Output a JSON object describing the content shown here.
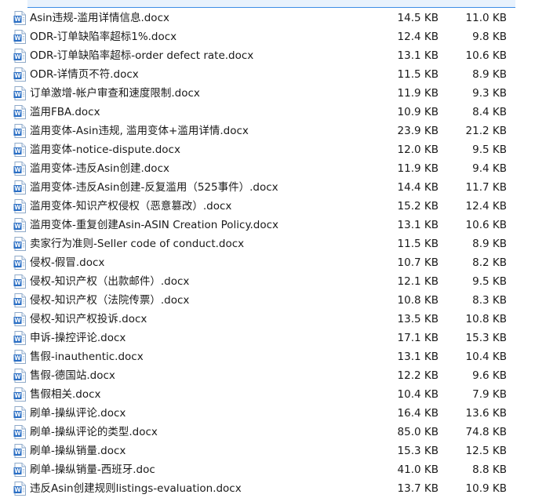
{
  "file_icon": "word-document-icon",
  "colors": {
    "icon_blue": "#2b6fc4",
    "selection": "#3d8ee6",
    "text": "#1a1a1a"
  },
  "files": [
    {
      "name": "Asin违规-滥用详情信息.docx",
      "size": "14.5 KB",
      "compressed": "11.0 KB"
    },
    {
      "name": "ODR-订单缺陷率超标1%.docx",
      "size": "12.4 KB",
      "compressed": "9.8 KB"
    },
    {
      "name": "ODR-订单缺陷率超标-order defect rate.docx",
      "size": "13.1 KB",
      "compressed": "10.6 KB"
    },
    {
      "name": "ODR-详情页不符.docx",
      "size": "11.5 KB",
      "compressed": "8.9 KB"
    },
    {
      "name": "订单激增-帐户审查和速度限制.docx",
      "size": "11.9 KB",
      "compressed": "9.3 KB"
    },
    {
      "name": "滥用FBA.docx",
      "size": "10.9 KB",
      "compressed": "8.4 KB"
    },
    {
      "name": "滥用变体-Asin违规, 滥用变体+滥用详情.docx",
      "size": "23.9 KB",
      "compressed": "21.2 KB"
    },
    {
      "name": "滥用变体-notice-dispute.docx",
      "size": "12.0 KB",
      "compressed": "9.5 KB"
    },
    {
      "name": "滥用变体-违反Asin创建.docx",
      "size": "11.9 KB",
      "compressed": "9.4 KB"
    },
    {
      "name": "滥用变体-违反Asin创建-反复滥用（525事件）.docx",
      "size": "14.4 KB",
      "compressed": "11.7 KB"
    },
    {
      "name": "滥用变体-知识产权侵权（恶意篡改）.docx",
      "size": "15.2 KB",
      "compressed": "12.4 KB"
    },
    {
      "name": "滥用变体-重复创建Asin-ASIN Creation Policy.docx",
      "size": "13.1 KB",
      "compressed": "10.6 KB"
    },
    {
      "name": "卖家行为准则-Seller code of conduct.docx",
      "size": "11.5 KB",
      "compressed": "8.9 KB"
    },
    {
      "name": "侵权-假冒.docx",
      "size": "10.7 KB",
      "compressed": "8.2 KB"
    },
    {
      "name": "侵权-知识产权（出款邮件）.docx",
      "size": "12.1 KB",
      "compressed": "9.5 KB"
    },
    {
      "name": "侵权-知识产权（法院传票）.docx",
      "size": "10.8 KB",
      "compressed": "8.3 KB"
    },
    {
      "name": "侵权-知识产权投诉.docx",
      "size": "13.5 KB",
      "compressed": "10.8 KB"
    },
    {
      "name": "申诉-操控评论.docx",
      "size": "17.1 KB",
      "compressed": "15.3 KB"
    },
    {
      "name": "售假-inauthentic.docx",
      "size": "13.1 KB",
      "compressed": "10.4 KB"
    },
    {
      "name": "售假-德国站.docx",
      "size": "12.2 KB",
      "compressed": "9.6 KB"
    },
    {
      "name": "售假相关.docx",
      "size": "10.4 KB",
      "compressed": "7.9 KB"
    },
    {
      "name": "刷单-操纵评论.docx",
      "size": "16.4 KB",
      "compressed": "13.6 KB"
    },
    {
      "name": "刷单-操纵评论的类型.docx",
      "size": "85.0 KB",
      "compressed": "74.8 KB"
    },
    {
      "name": "刷单-操纵销量.docx",
      "size": "15.3 KB",
      "compressed": "12.5 KB"
    },
    {
      "name": "刷单-操纵销量-西班牙.doc",
      "size": "41.0 KB",
      "compressed": "8.8 KB"
    },
    {
      "name": "违反Asin创建规则listings-evaluation.docx",
      "size": "13.7 KB",
      "compressed": "10.9 KB"
    }
  ]
}
